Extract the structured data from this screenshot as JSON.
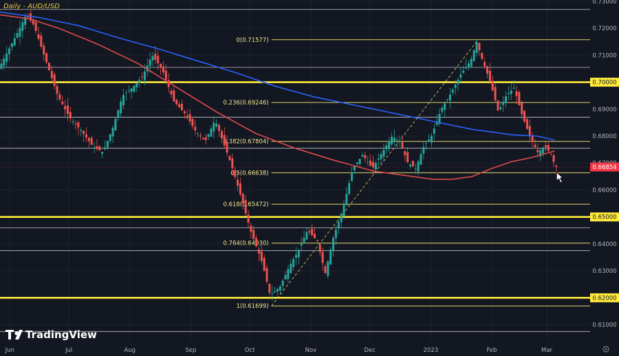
{
  "chart_data": {
    "type": "candlestick",
    "title": "Daily - AUD/USD",
    "brand": "TradingView",
    "ylim": [
      0.6035,
      0.7305
    ],
    "y_ticks": [
      "0.73000",
      "0.72000",
      "0.71000",
      "0.70000",
      "0.69000",
      "0.68000",
      "0.67000",
      "0.66000",
      "0.65000",
      "0.64000",
      "0.63000",
      "0.62000",
      "0.61000"
    ],
    "x_ticks": [
      {
        "label": "Jun",
        "day": 5
      },
      {
        "label": "Jul",
        "day": 35
      },
      {
        "label": "Aug",
        "day": 66
      },
      {
        "label": "Sep",
        "day": 97
      },
      {
        "label": "Oct",
        "day": 127
      },
      {
        "label": "Nov",
        "day": 158
      },
      {
        "label": "Dec",
        "day": 188
      },
      {
        "label": "2023",
        "day": 219
      },
      {
        "label": "Feb",
        "day": 250
      },
      {
        "label": "Mar",
        "day": 278
      }
    ],
    "x_range_days": [
      0,
      300
    ],
    "current_price": {
      "value": 0.66854,
      "label": "0.66854",
      "color": "#f23645"
    },
    "key_levels": [
      {
        "value": 0.7,
        "label": "0.70000",
        "color": "#ffeb3b"
      },
      {
        "value": 0.65,
        "label": "0.65000",
        "color": "#ffeb3b"
      },
      {
        "value": 0.62,
        "label": "0.62000",
        "color": "#ffeb3b"
      }
    ],
    "fibonacci": {
      "color": "#e6d96a",
      "levels": [
        {
          "value": 0.71577,
          "label": "0(0.71577)"
        },
        {
          "value": 0.69246,
          "label": "0.236(0.69246)"
        },
        {
          "value": 0.67804,
          "label": "0.382(0.67804)"
        },
        {
          "value": 0.66638,
          "label": "0.5(0.66638)"
        },
        {
          "value": 0.65472,
          "label": "0.618(0.65472)"
        },
        {
          "value": 0.6403,
          "label": "0.764(0.64030)"
        },
        {
          "value": 0.61699,
          "label": "1(0.61699)"
        }
      ],
      "trend_line": {
        "from": {
          "day": 138,
          "value": 0.61699
        },
        "to": {
          "day": 243,
          "value": 0.71577
        }
      }
    },
    "horizontal_lines": [
      {
        "value": 0.727,
        "color": "#ffffff",
        "style": "solid"
      },
      {
        "value": 0.7055,
        "color": "#ffffff",
        "style": "solid"
      },
      {
        "value": 0.687,
        "color": "#ffffff",
        "style": "solid"
      },
      {
        "value": 0.6755,
        "color": "#ffffff",
        "style": "solid"
      },
      {
        "value": 0.646,
        "color": "#ffffff",
        "style": "solid"
      },
      {
        "value": 0.6375,
        "color": "#ffffff",
        "style": "solid"
      },
      {
        "value": 0.6075,
        "color": "#ffffff",
        "style": "solid"
      },
      {
        "value": 0.6685,
        "color": "#f23645",
        "style": "dotted"
      }
    ],
    "series": [
      {
        "type": "line",
        "color": "#2962ff",
        "points": [
          [
            0,
            0.726
          ],
          [
            20,
            0.724
          ],
          [
            40,
            0.721
          ],
          [
            60,
            0.7165
          ],
          [
            80,
            0.7125
          ],
          [
            100,
            0.708
          ],
          [
            120,
            0.7035
          ],
          [
            140,
            0.6985
          ],
          [
            160,
            0.6945
          ],
          [
            180,
            0.6915
          ],
          [
            200,
            0.6885
          ],
          [
            220,
            0.6855
          ],
          [
            240,
            0.6825
          ],
          [
            260,
            0.6805
          ],
          [
            273,
            0.68
          ],
          [
            282,
            0.6785
          ]
        ]
      },
      {
        "type": "line",
        "color": "#e04a4a",
        "points": [
          [
            0,
            0.725
          ],
          [
            15,
            0.7235
          ],
          [
            30,
            0.72
          ],
          [
            50,
            0.714
          ],
          [
            70,
            0.707
          ],
          [
            90,
            0.698
          ],
          [
            110,
            0.689
          ],
          [
            130,
            0.681
          ],
          [
            150,
            0.6755
          ],
          [
            170,
            0.671
          ],
          [
            190,
            0.667
          ],
          [
            205,
            0.6655
          ],
          [
            220,
            0.664
          ],
          [
            230,
            0.664
          ],
          [
            240,
            0.665
          ],
          [
            250,
            0.668
          ],
          [
            260,
            0.6705
          ],
          [
            270,
            0.672
          ],
          [
            282,
            0.6745
          ]
        ]
      }
    ],
    "price_path": [
      [
        0,
        0.705
      ],
      [
        5,
        0.712
      ],
      [
        10,
        0.719
      ],
      [
        14,
        0.725
      ],
      [
        18,
        0.721
      ],
      [
        24,
        0.708
      ],
      [
        30,
        0.695
      ],
      [
        36,
        0.687
      ],
      [
        42,
        0.682
      ],
      [
        48,
        0.676
      ],
      [
        53,
        0.674
      ],
      [
        58,
        0.683
      ],
      [
        63,
        0.695
      ],
      [
        68,
        0.698
      ],
      [
        73,
        0.702
      ],
      [
        78,
        0.71
      ],
      [
        83,
        0.705
      ],
      [
        89,
        0.693
      ],
      [
        95,
        0.688
      ],
      [
        100,
        0.682
      ],
      [
        105,
        0.678
      ],
      [
        110,
        0.686
      ],
      [
        113,
        0.68
      ],
      [
        118,
        0.67
      ],
      [
        123,
        0.658
      ],
      [
        128,
        0.645
      ],
      [
        134,
        0.633
      ],
      [
        138,
        0.621
      ],
      [
        143,
        0.624
      ],
      [
        148,
        0.632
      ],
      [
        152,
        0.637
      ],
      [
        157,
        0.645
      ],
      [
        162,
        0.641
      ],
      [
        166,
        0.629
      ],
      [
        170,
        0.642
      ],
      [
        175,
        0.653
      ],
      [
        180,
        0.668
      ],
      [
        185,
        0.673
      ],
      [
        190,
        0.668
      ],
      [
        195,
        0.674
      ],
      [
        200,
        0.68
      ],
      [
        204,
        0.678
      ],
      [
        208,
        0.67
      ],
      [
        212,
        0.668
      ],
      [
        216,
        0.676
      ],
      [
        220,
        0.68
      ],
      [
        225,
        0.69
      ],
      [
        230,
        0.696
      ],
      [
        235,
        0.703
      ],
      [
        240,
        0.708
      ],
      [
        243,
        0.715
      ],
      [
        246,
        0.708
      ],
      [
        250,
        0.7
      ],
      [
        254,
        0.689
      ],
      [
        258,
        0.695
      ],
      [
        262,
        0.698
      ],
      [
        266,
        0.688
      ],
      [
        270,
        0.68
      ],
      [
        274,
        0.674
      ],
      [
        278,
        0.676
      ],
      [
        281,
        0.673
      ],
      [
        283,
        0.6685
      ]
    ],
    "cursor": {
      "day": 283,
      "value": 0.6665
    }
  }
}
